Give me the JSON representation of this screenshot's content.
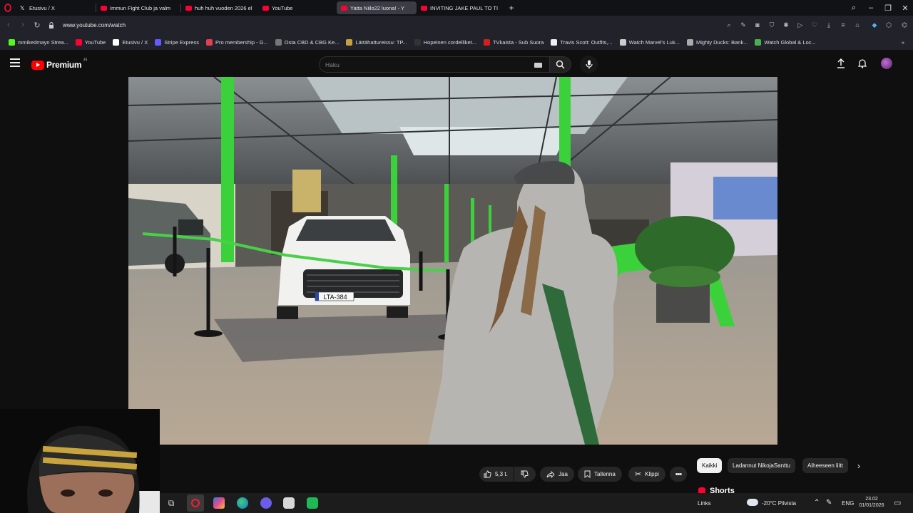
{
  "browser": {
    "tabs": [
      {
        "label": "Etusivu / X",
        "icon": "x-logo",
        "active": false
      },
      {
        "label": "Immun Fight Club ja valm",
        "icon": "youtube-icon",
        "active": false
      },
      {
        "label": "huh huh vuoden 2026 el",
        "icon": "youtube-icon",
        "active": false
      },
      {
        "label": "YouTube",
        "icon": "youtube-icon",
        "active": false
      },
      {
        "label": "Yatta Niilo22 luona! - Y",
        "icon": "youtube-icon",
        "active": true
      },
      {
        "label": "INVITING JAKE PAUL TO TI",
        "icon": "youtube-icon",
        "active": false
      }
    ],
    "url": "www.youtube.com/watch",
    "bookmarks": [
      {
        "label": "mmikedmayn Strea...",
        "color": "#53fc18"
      },
      {
        "label": "YouTube",
        "color": "#ff0033"
      },
      {
        "label": "Etusivu / X",
        "color": "#ffffff"
      },
      {
        "label": "Stripe Express",
        "color": "#635bff"
      },
      {
        "label": "Pro membership - G...",
        "color": "#e04050"
      },
      {
        "label": "Osta CBD & CBG Ke...",
        "color": "#777777"
      },
      {
        "label": "Lättähattureissu: TP...",
        "color": "#c8a040"
      },
      {
        "label": "Hopeinen cordelliket...",
        "color": "#333333"
      },
      {
        "label": "TVkaista - Sub Suora",
        "color": "#d02020"
      },
      {
        "label": "Travis Scott: Outfits,...",
        "color": "#f0f0f0"
      },
      {
        "label": "Watch Marvel's Luk...",
        "color": "#cccccc"
      },
      {
        "label": "Mighty Ducks: Bank...",
        "color": "#aaaaaa"
      },
      {
        "label": "Watch Global & Loc...",
        "color": "#4caf50"
      }
    ]
  },
  "youtube": {
    "brand": "Premium",
    "region": "FI",
    "search_placeholder": "Haku"
  },
  "actions": {
    "likes": "5,3 t.",
    "share": "Jaa",
    "save": "Tallenna",
    "clip": "Klippi"
  },
  "chips": [
    "Kaikki",
    "Ladannut NikojaSanttu",
    "Aiheeseen liitt"
  ],
  "shorts_label": "Shorts",
  "taskbar": {
    "links_label": "Links",
    "weather": "-20°C Pilvista",
    "language": "ENG",
    "time": "23.02",
    "date": "01/01/2026"
  },
  "video": {
    "plate": "LTA-384"
  },
  "colors": {
    "accent_red": "#ff0000",
    "tab_active": "#3b3c44",
    "green_pillars": "#3bd13b"
  }
}
